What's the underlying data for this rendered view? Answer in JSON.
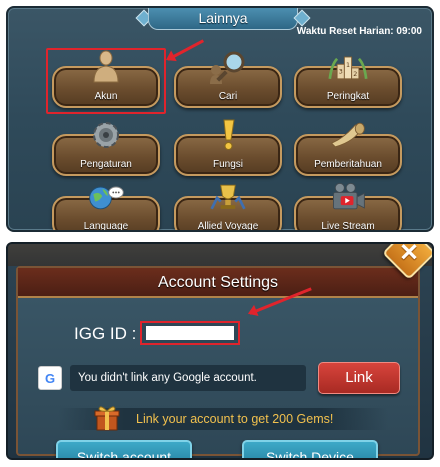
{
  "top_panel": {
    "title": "Lainnya",
    "reset_text": "Waktu Reset Harian: 09:00",
    "tiles": [
      {
        "label": "Akun",
        "icon": "account-bust-icon"
      },
      {
        "label": "Cari",
        "icon": "search-magnifier-icon"
      },
      {
        "label": "Peringkat",
        "icon": "ranking-podium-icon"
      },
      {
        "label": "Pengaturan",
        "icon": "gear-icon"
      },
      {
        "label": "Fungsi",
        "icon": "exclamation-icon"
      },
      {
        "label": "Pemberitahuan",
        "icon": "horn-icon"
      },
      {
        "label": "Language",
        "icon": "globe-chat-icon"
      },
      {
        "label": "Allied Voyage",
        "icon": "trophy-icon"
      },
      {
        "label": "Live Stream",
        "icon": "video-camera-icon"
      }
    ]
  },
  "account_settings": {
    "title": "Account Settings",
    "close_symbol": "✕",
    "igg_label": "IGG ID :",
    "google_icon_letter": "G",
    "google_message": "You didn't link any Google account.",
    "link_button": "Link",
    "gems_promo": "Link your account to get 200 Gems!",
    "switch_account_button": "Switch account",
    "switch_device_button": "Switch Device"
  },
  "colors": {
    "highlight": "#e0242c",
    "gold_text": "#f2c14e",
    "link_red": "#c0352d",
    "teal_button": "#2b8fb0"
  }
}
